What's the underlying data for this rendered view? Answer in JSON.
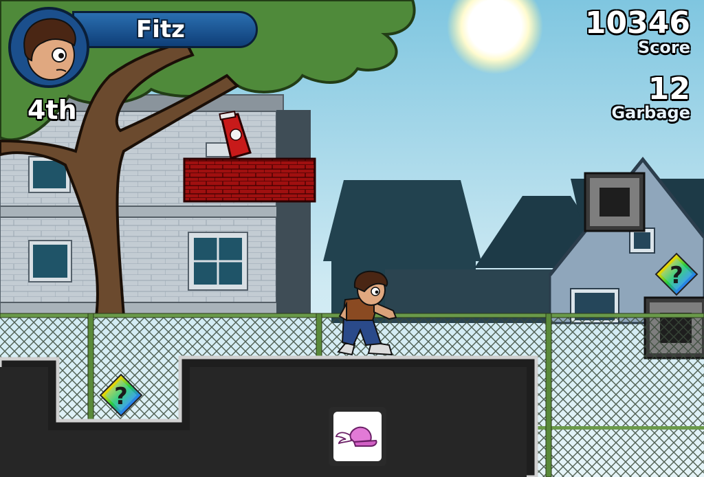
{
  "hud": {
    "player_name": "Fitz",
    "rank": "4th",
    "score": "10346",
    "score_label": "Score",
    "garbage": "12",
    "garbage_label": "Garbage"
  },
  "icons": {
    "avatar": "fitz-portrait-icon",
    "powerup": "winged-cap-icon",
    "mystery_box": "rainbow-question-diamond-icon",
    "garbage_item": "soda-bottle-icon"
  },
  "colors": {
    "banner": "#1a5596",
    "sky": "#bfe3f0",
    "ground": "#1e1e1e",
    "fence": "#5a8a3a",
    "brick": "#9b0f0f"
  }
}
